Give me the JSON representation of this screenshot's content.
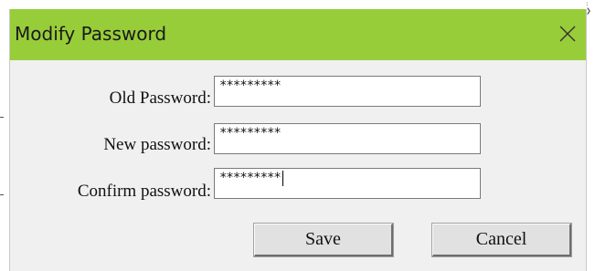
{
  "dialog": {
    "title": "Modify Password",
    "close_icon": "close-icon",
    "title_bar_color": "#98cd3a"
  },
  "form": {
    "old_password": {
      "label": "Old Password:",
      "value": "*********"
    },
    "new_password": {
      "label": "New password:",
      "value": "*********"
    },
    "confirm_password": {
      "label": "Confirm password:",
      "value": "*********"
    }
  },
  "buttons": {
    "save_label": "Save",
    "cancel_label": "Cancel"
  }
}
